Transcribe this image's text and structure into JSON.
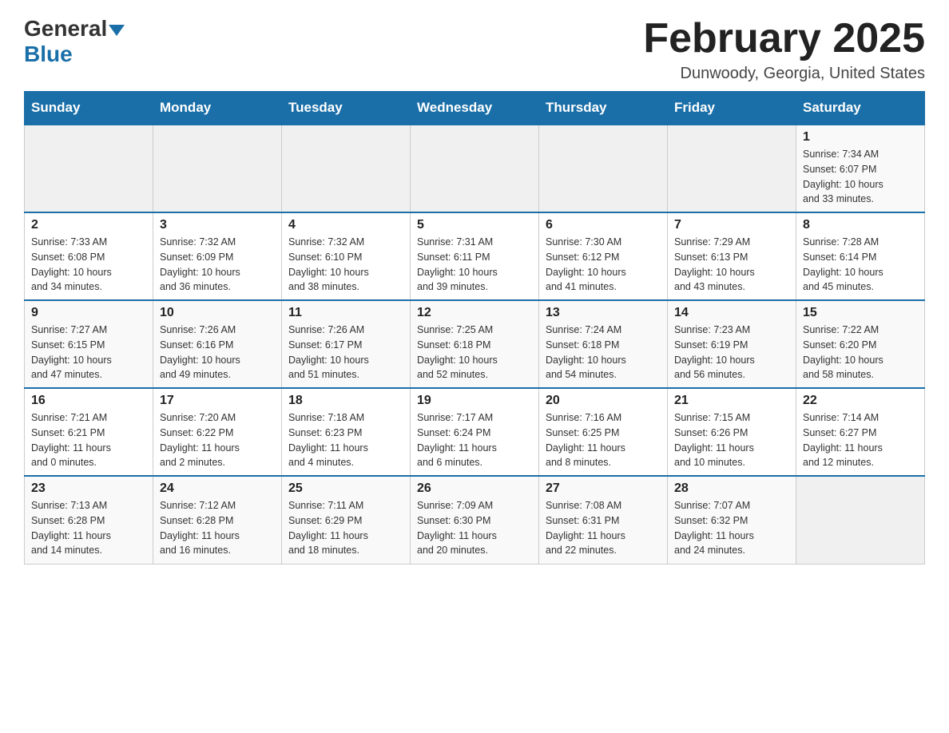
{
  "header": {
    "logo_general": "General",
    "logo_blue": "Blue",
    "month_title": "February 2025",
    "location": "Dunwoody, Georgia, United States"
  },
  "weekdays": [
    "Sunday",
    "Monday",
    "Tuesday",
    "Wednesday",
    "Thursday",
    "Friday",
    "Saturday"
  ],
  "weeks": [
    [
      {
        "day": "",
        "info": ""
      },
      {
        "day": "",
        "info": ""
      },
      {
        "day": "",
        "info": ""
      },
      {
        "day": "",
        "info": ""
      },
      {
        "day": "",
        "info": ""
      },
      {
        "day": "",
        "info": ""
      },
      {
        "day": "1",
        "info": "Sunrise: 7:34 AM\nSunset: 6:07 PM\nDaylight: 10 hours\nand 33 minutes."
      }
    ],
    [
      {
        "day": "2",
        "info": "Sunrise: 7:33 AM\nSunset: 6:08 PM\nDaylight: 10 hours\nand 34 minutes."
      },
      {
        "day": "3",
        "info": "Sunrise: 7:32 AM\nSunset: 6:09 PM\nDaylight: 10 hours\nand 36 minutes."
      },
      {
        "day": "4",
        "info": "Sunrise: 7:32 AM\nSunset: 6:10 PM\nDaylight: 10 hours\nand 38 minutes."
      },
      {
        "day": "5",
        "info": "Sunrise: 7:31 AM\nSunset: 6:11 PM\nDaylight: 10 hours\nand 39 minutes."
      },
      {
        "day": "6",
        "info": "Sunrise: 7:30 AM\nSunset: 6:12 PM\nDaylight: 10 hours\nand 41 minutes."
      },
      {
        "day": "7",
        "info": "Sunrise: 7:29 AM\nSunset: 6:13 PM\nDaylight: 10 hours\nand 43 minutes."
      },
      {
        "day": "8",
        "info": "Sunrise: 7:28 AM\nSunset: 6:14 PM\nDaylight: 10 hours\nand 45 minutes."
      }
    ],
    [
      {
        "day": "9",
        "info": "Sunrise: 7:27 AM\nSunset: 6:15 PM\nDaylight: 10 hours\nand 47 minutes."
      },
      {
        "day": "10",
        "info": "Sunrise: 7:26 AM\nSunset: 6:16 PM\nDaylight: 10 hours\nand 49 minutes."
      },
      {
        "day": "11",
        "info": "Sunrise: 7:26 AM\nSunset: 6:17 PM\nDaylight: 10 hours\nand 51 minutes."
      },
      {
        "day": "12",
        "info": "Sunrise: 7:25 AM\nSunset: 6:18 PM\nDaylight: 10 hours\nand 52 minutes."
      },
      {
        "day": "13",
        "info": "Sunrise: 7:24 AM\nSunset: 6:18 PM\nDaylight: 10 hours\nand 54 minutes."
      },
      {
        "day": "14",
        "info": "Sunrise: 7:23 AM\nSunset: 6:19 PM\nDaylight: 10 hours\nand 56 minutes."
      },
      {
        "day": "15",
        "info": "Sunrise: 7:22 AM\nSunset: 6:20 PM\nDaylight: 10 hours\nand 58 minutes."
      }
    ],
    [
      {
        "day": "16",
        "info": "Sunrise: 7:21 AM\nSunset: 6:21 PM\nDaylight: 11 hours\nand 0 minutes."
      },
      {
        "day": "17",
        "info": "Sunrise: 7:20 AM\nSunset: 6:22 PM\nDaylight: 11 hours\nand 2 minutes."
      },
      {
        "day": "18",
        "info": "Sunrise: 7:18 AM\nSunset: 6:23 PM\nDaylight: 11 hours\nand 4 minutes."
      },
      {
        "day": "19",
        "info": "Sunrise: 7:17 AM\nSunset: 6:24 PM\nDaylight: 11 hours\nand 6 minutes."
      },
      {
        "day": "20",
        "info": "Sunrise: 7:16 AM\nSunset: 6:25 PM\nDaylight: 11 hours\nand 8 minutes."
      },
      {
        "day": "21",
        "info": "Sunrise: 7:15 AM\nSunset: 6:26 PM\nDaylight: 11 hours\nand 10 minutes."
      },
      {
        "day": "22",
        "info": "Sunrise: 7:14 AM\nSunset: 6:27 PM\nDaylight: 11 hours\nand 12 minutes."
      }
    ],
    [
      {
        "day": "23",
        "info": "Sunrise: 7:13 AM\nSunset: 6:28 PM\nDaylight: 11 hours\nand 14 minutes."
      },
      {
        "day": "24",
        "info": "Sunrise: 7:12 AM\nSunset: 6:28 PM\nDaylight: 11 hours\nand 16 minutes."
      },
      {
        "day": "25",
        "info": "Sunrise: 7:11 AM\nSunset: 6:29 PM\nDaylight: 11 hours\nand 18 minutes."
      },
      {
        "day": "26",
        "info": "Sunrise: 7:09 AM\nSunset: 6:30 PM\nDaylight: 11 hours\nand 20 minutes."
      },
      {
        "day": "27",
        "info": "Sunrise: 7:08 AM\nSunset: 6:31 PM\nDaylight: 11 hours\nand 22 minutes."
      },
      {
        "day": "28",
        "info": "Sunrise: 7:07 AM\nSunset: 6:32 PM\nDaylight: 11 hours\nand 24 minutes."
      },
      {
        "day": "",
        "info": ""
      }
    ]
  ]
}
